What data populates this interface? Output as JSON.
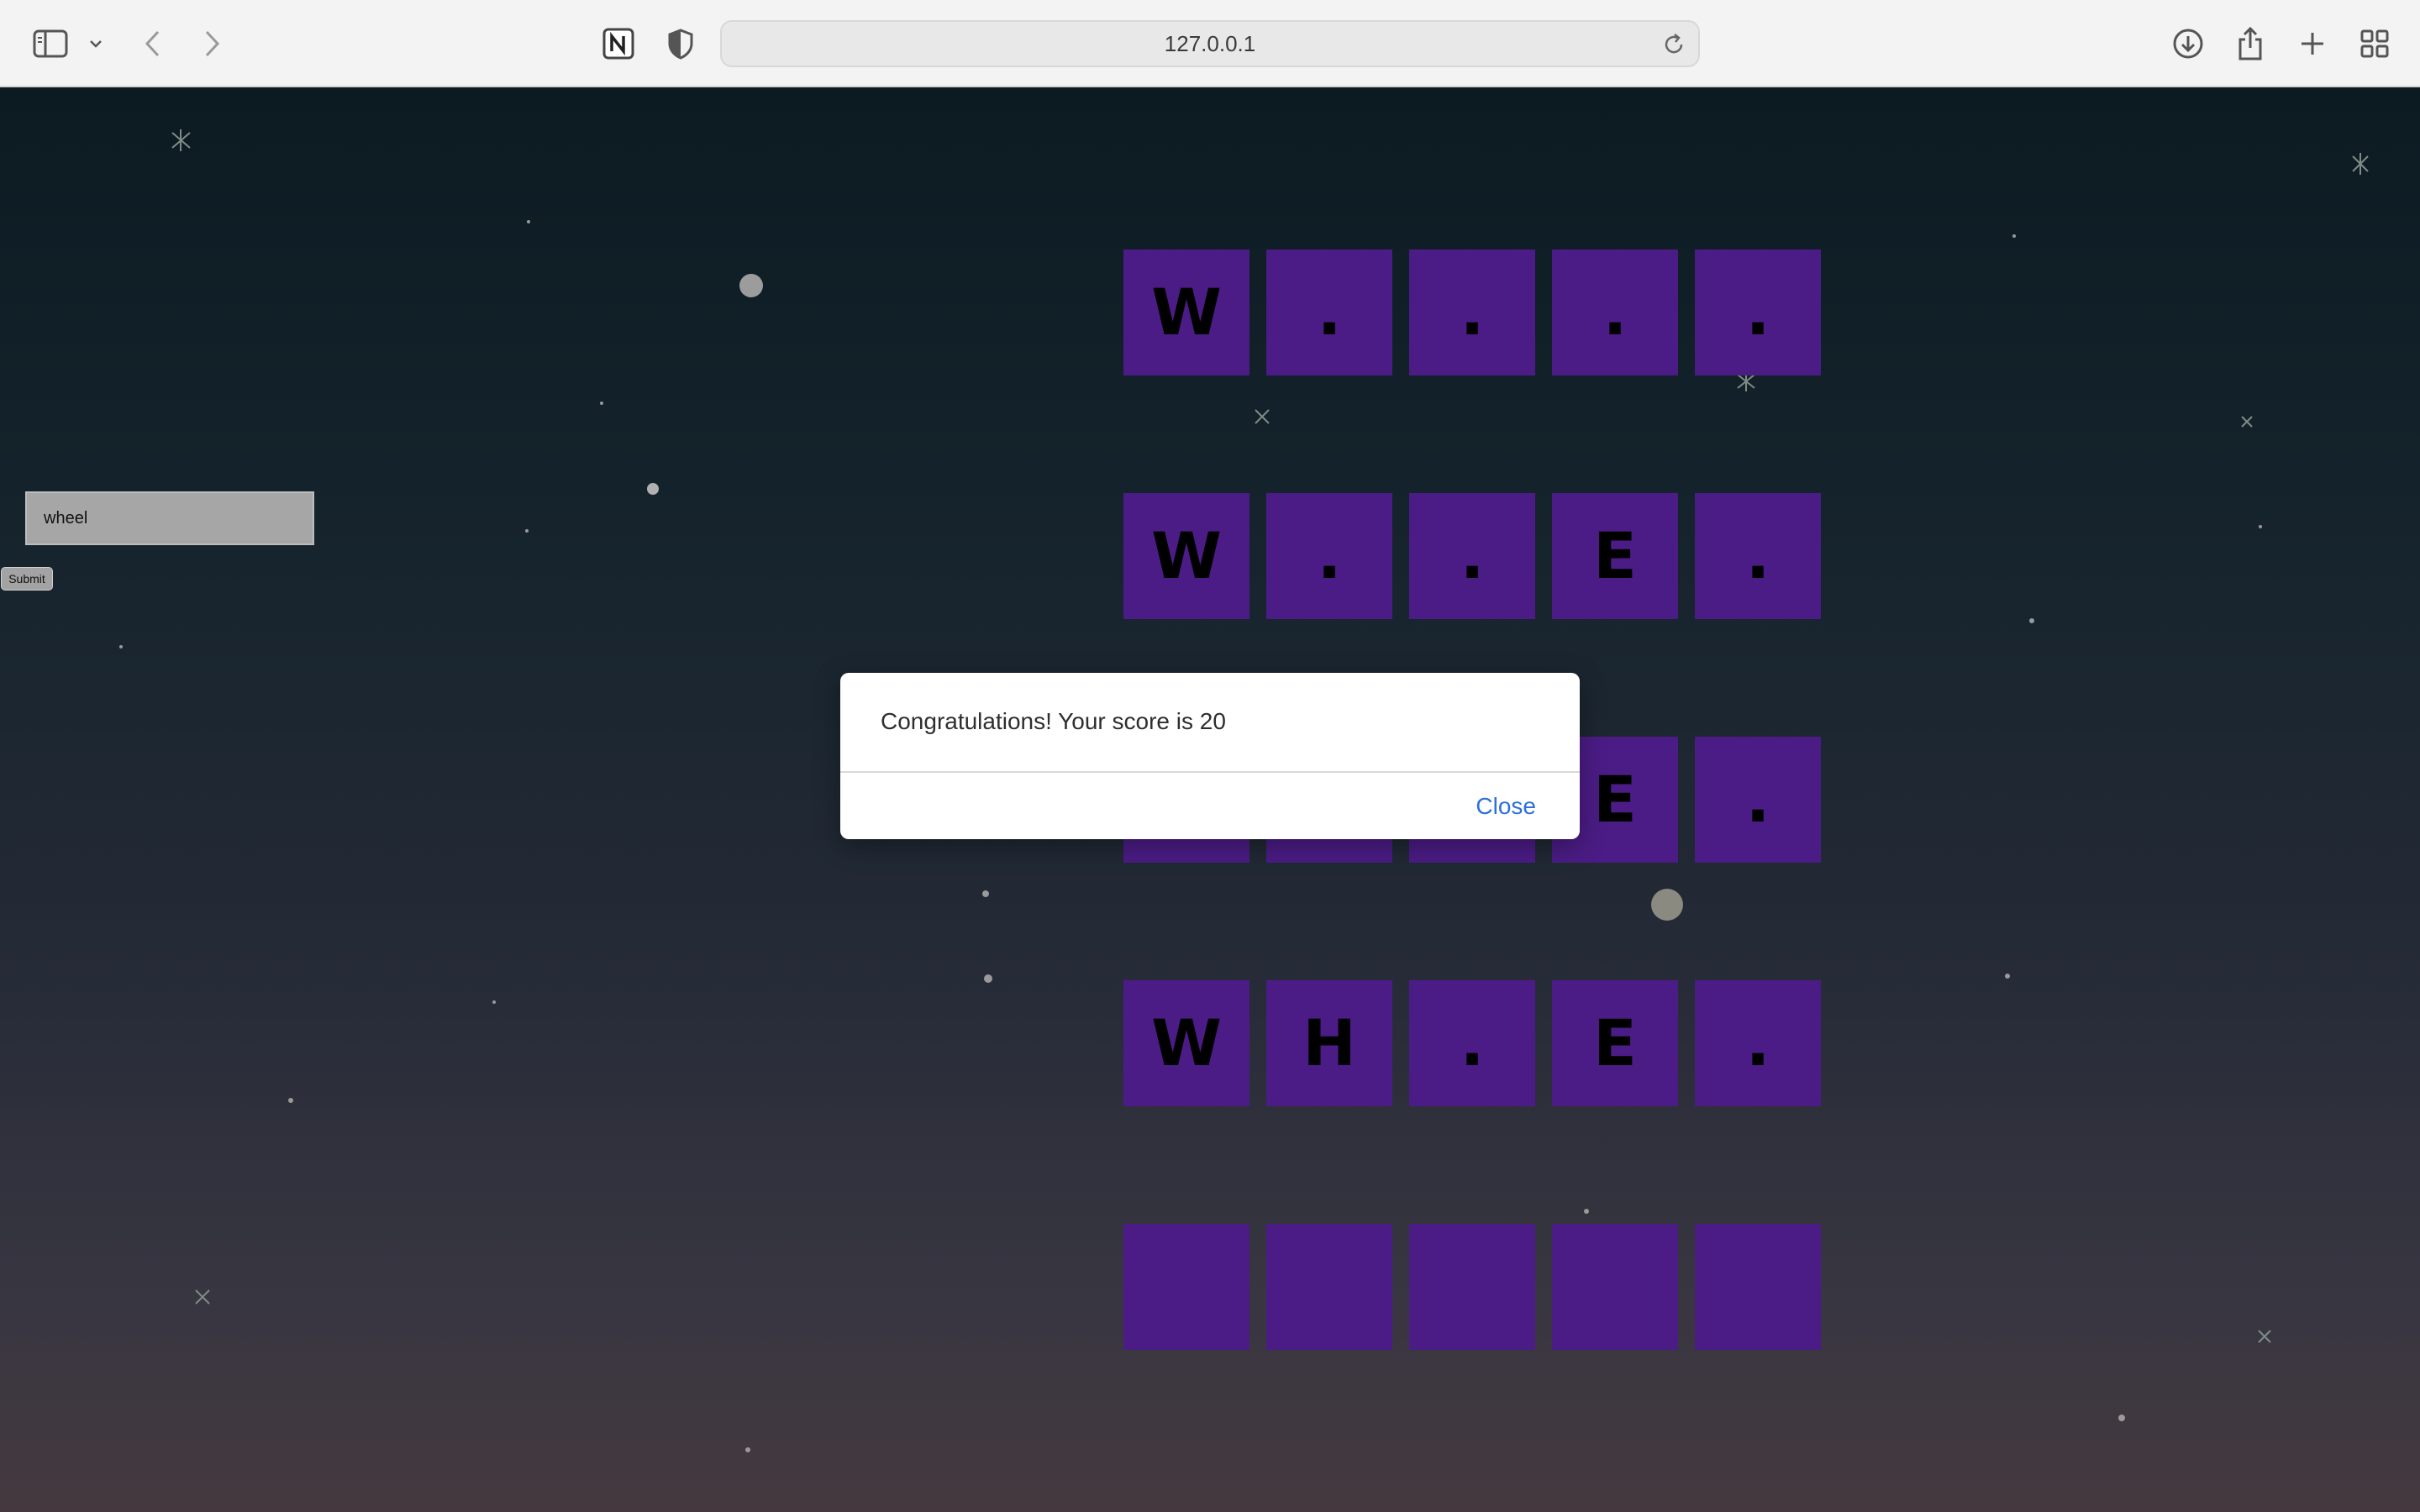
{
  "browser": {
    "url": "127.0.0.1",
    "icons": {
      "sidebar": "sidebar-icon",
      "sidebar_menu": "chevron-down-icon",
      "back": "back-arrow-icon",
      "forward": "forward-arrow-icon",
      "notion": "notion-extension-icon",
      "privacy": "shield-icon",
      "reload": "reload-icon",
      "downloads": "download-icon",
      "share": "share-icon",
      "new_tab": "plus-icon",
      "tab_overview": "grid-icon"
    }
  },
  "game": {
    "input_value": "wheel",
    "submit_label": "Submit",
    "tile_color": "#4b1c85",
    "board": [
      [
        "W",
        ".",
        ".",
        ".",
        "."
      ],
      [
        "W",
        ".",
        ".",
        "E",
        "."
      ],
      [
        "",
        "",
        "",
        "E",
        "."
      ],
      [
        "W",
        "H",
        ".",
        "E",
        "."
      ],
      [
        "",
        "",
        "",
        "",
        ""
      ]
    ]
  },
  "dialog": {
    "message": "Congratulations! Your score is 20",
    "close_label": "Close"
  }
}
